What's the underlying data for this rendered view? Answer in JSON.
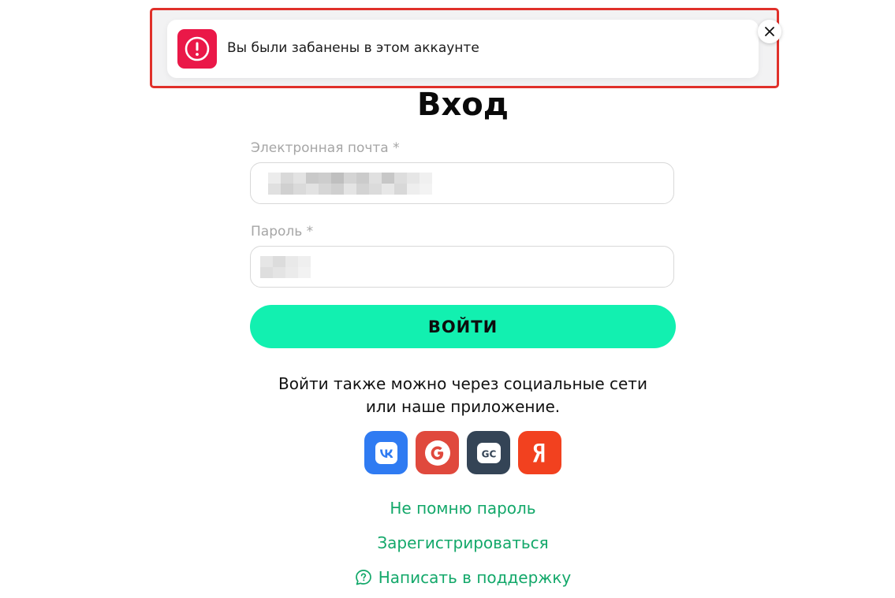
{
  "toast": {
    "message": "Вы были забанены в этом аккаунте",
    "icon": "alert-circle-icon",
    "close_icon": "close-icon",
    "accent": "#ea1848",
    "frame_color": "#e0302a"
  },
  "login_form": {
    "title": "Вход",
    "email": {
      "label": "Электронная почта *",
      "value": ""
    },
    "password": {
      "label": "Пароль *",
      "value": ""
    },
    "submit_label": "ВОЙТИ",
    "submit_color": "#12f0b0"
  },
  "social_login": {
    "text_line1": "Войти также можно через социальные сети",
    "text_line2": "или наше приложение.",
    "providers": [
      {
        "name": "vk-icon",
        "color": "#2f7bf2"
      },
      {
        "name": "google-icon",
        "color": "#e0493d"
      },
      {
        "name": "gc-icon",
        "color": "#344456"
      },
      {
        "name": "yandex-icon",
        "color": "#f2411f"
      }
    ]
  },
  "links": {
    "forgot_password": "Не помню пароль",
    "register": "Зарегистрироваться",
    "support": "Написать в поддержку",
    "color": "#13a86a"
  }
}
